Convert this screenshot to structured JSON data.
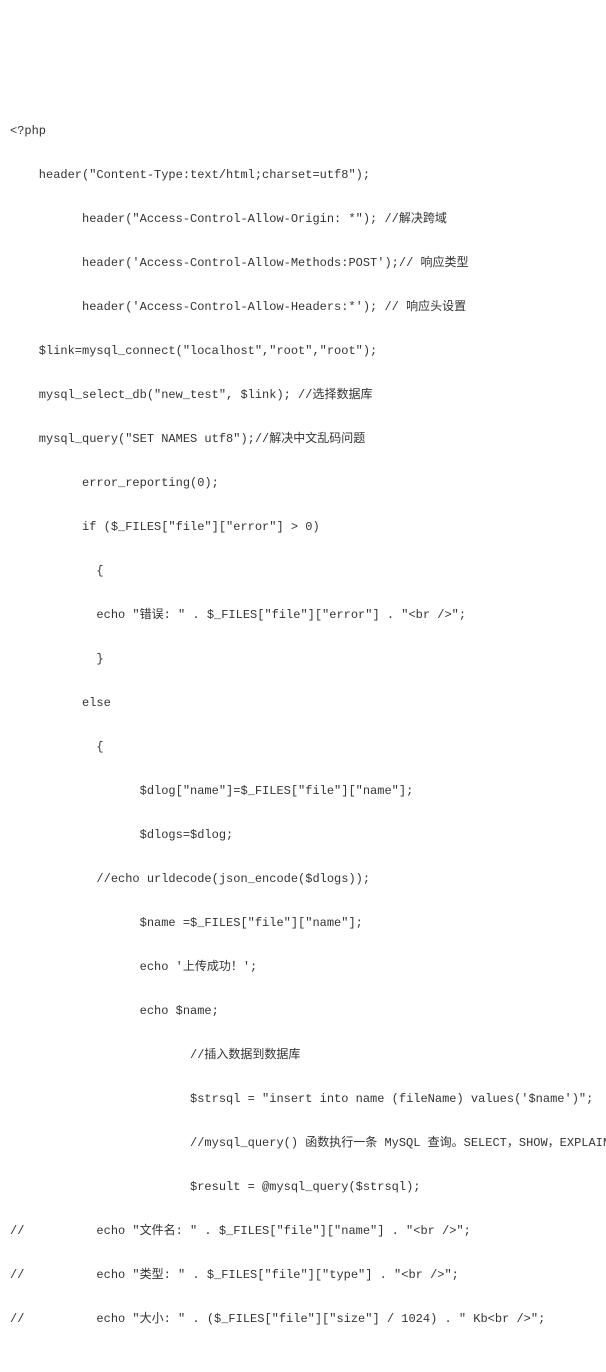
{
  "code": {
    "lines": [
      "<?php",
      "    header(\"Content-Type:text/html;charset=utf8\");",
      "          header(\"Access-Control-Allow-Origin: *\"); //解决跨域",
      "          header('Access-Control-Allow-Methods:POST');// 响应类型",
      "          header('Access-Control-Allow-Headers:*'); // 响应头设置",
      "    $link=mysql_connect(\"localhost\",\"root\",\"root\");",
      "    mysql_select_db(\"new_test\", $link); //选择数据库",
      "    mysql_query(\"SET NAMES utf8\");//解决中文乱码问题",
      "          error_reporting(0);",
      "          if ($_FILES[\"file\"][\"error\"] > 0)",
      "            {",
      "            echo \"错误: \" . $_FILES[\"file\"][\"error\"] . \"<br />\";",
      "            }",
      "          else",
      "            {",
      "                  $dlog[\"name\"]=$_FILES[\"file\"][\"name\"];",
      "                  $dlogs=$dlog;",
      "            //echo urldecode(json_encode($dlogs));",
      "                  $name =$_FILES[\"file\"][\"name\"];",
      "                  echo '上传成功！';",
      "                  echo $name;",
      "                         //插入数据到数据库",
      "                         $strsql = \"insert into name (fileName) values('$name')\";",
      "                         //mysql_query() 函数执行一条 MySQL 查询。SELECT，SHOW，EXPLAIN",
      "                         $result = @mysql_query($strsql);",
      "//          echo \"文件名: \" . $_FILES[\"file\"][\"name\"] . \"<br />\";",
      "//          echo \"类型: \" . $_FILES[\"file\"][\"type\"] . \"<br />\";",
      "//          echo \"大小: \" . ($_FILES[\"file\"][\"size\"] / 1024) . \" Kb<br />\";"
    ]
  }
}
